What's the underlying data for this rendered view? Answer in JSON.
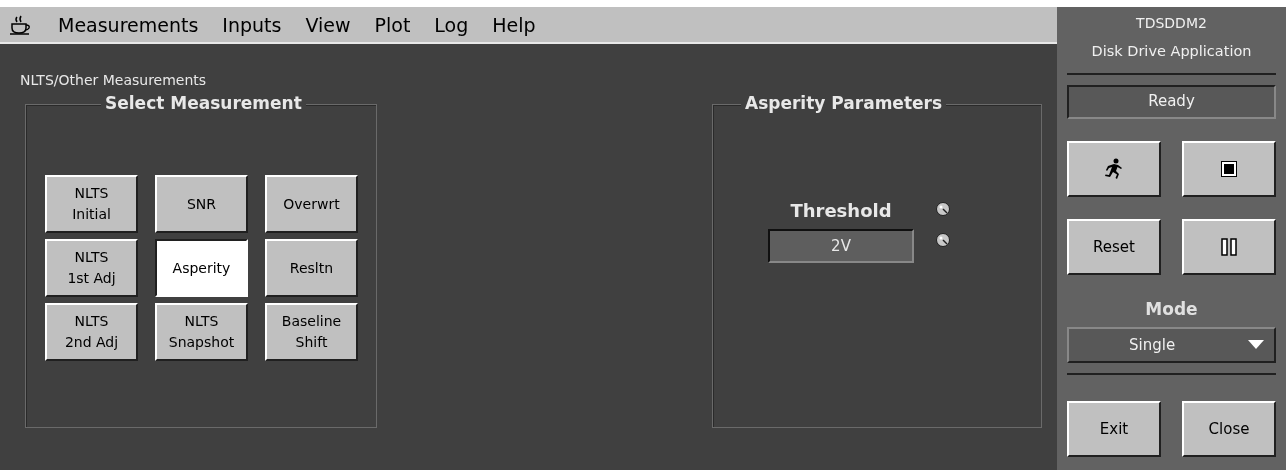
{
  "menu_bar": {
    "items": [
      "Measurements",
      "Inputs",
      "View",
      "Plot",
      "Log",
      "Help"
    ]
  },
  "subtitle": "NLTS/Other Measurements",
  "select_measurement": {
    "title": "Select Measurement",
    "buttons": [
      {
        "label": "NLTS\nInitial",
        "selected": false
      },
      {
        "label": "SNR",
        "selected": false
      },
      {
        "label": "Overwrt",
        "selected": false
      },
      {
        "label": "NLTS\n1st Adj",
        "selected": false
      },
      {
        "label": "Asperity",
        "selected": true
      },
      {
        "label": "Resltn",
        "selected": false
      },
      {
        "label": "NLTS\n2nd Adj",
        "selected": false
      },
      {
        "label": "NLTS\nSnapshot",
        "selected": false
      },
      {
        "label": "Baseline\nShift",
        "selected": false
      }
    ]
  },
  "asperity_parameters": {
    "title": "Asperity Parameters",
    "threshold": {
      "label": "Threshold",
      "value": "2V"
    }
  },
  "side_panel": {
    "title": "TDSDDM2",
    "subtitle": "Disk Drive Application",
    "status": "Ready",
    "controls": [
      {
        "kind": "run"
      },
      {
        "kind": "stop"
      },
      {
        "kind": "text",
        "label": "Reset"
      },
      {
        "kind": "pause"
      }
    ],
    "mode": {
      "label": "Mode",
      "value": "Single"
    },
    "buttons": [
      "Exit",
      "Close"
    ]
  }
}
